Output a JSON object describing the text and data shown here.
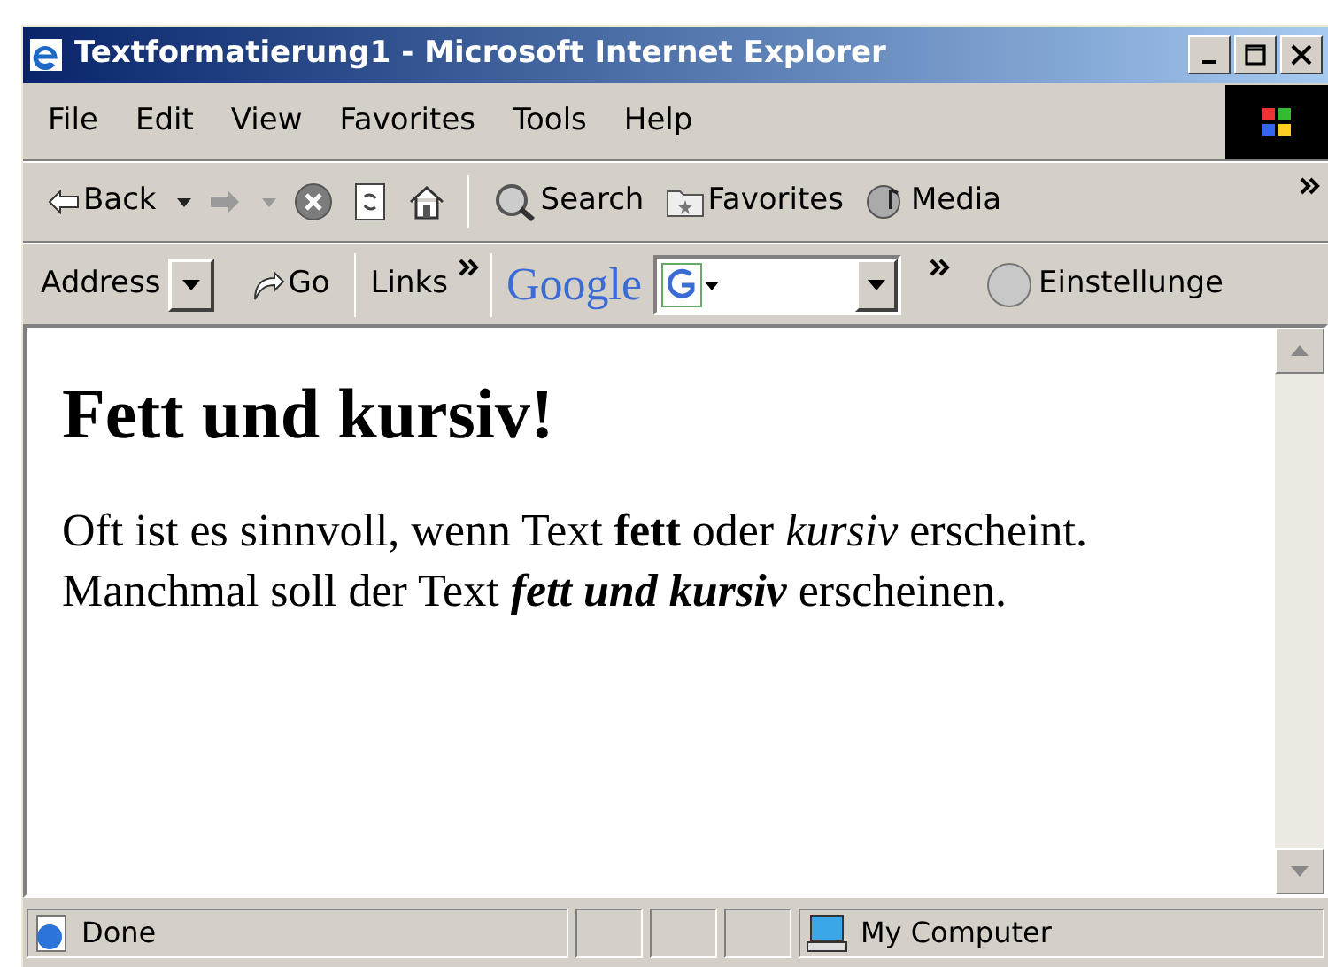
{
  "window": {
    "title": "Textformatierung1 - Microsoft Internet Explorer"
  },
  "menu": [
    "File",
    "Edit",
    "View",
    "Favorites",
    "Tools",
    "Help"
  ],
  "toolbar": [
    {
      "kind": "back",
      "label": "Back"
    },
    {
      "kind": "forward"
    },
    {
      "kind": "stop"
    },
    {
      "kind": "refresh"
    },
    {
      "kind": "home"
    },
    {
      "kind": "search",
      "label": "Search"
    },
    {
      "kind": "favorites",
      "label": "Favorites"
    },
    {
      "kind": "media",
      "label": "Media"
    }
  ],
  "address_bar": {
    "address_label": "Address",
    "go_label": "Go",
    "links_label": "Links",
    "google_label": "Google",
    "settings_label": "Einstellunge"
  },
  "page": {
    "heading": "Fett und kursiv!",
    "paragraph": [
      {
        "text": "Oft ist es sinnvoll, wenn Text ",
        "bold": false,
        "italic": false
      },
      {
        "text": "fett",
        "bold": true,
        "italic": false
      },
      {
        "text": " oder ",
        "bold": false,
        "italic": false
      },
      {
        "text": "kursiv",
        "bold": false,
        "italic": true
      },
      {
        "text": " erscheint. Manchmal soll der Text ",
        "bold": false,
        "italic": false
      },
      {
        "text": "fett und kursiv",
        "bold": true,
        "italic": true
      },
      {
        "text": " erscheinen.",
        "bold": false,
        "italic": false
      }
    ]
  },
  "status_bar": {
    "status": "Done",
    "zone": "My Computer"
  }
}
